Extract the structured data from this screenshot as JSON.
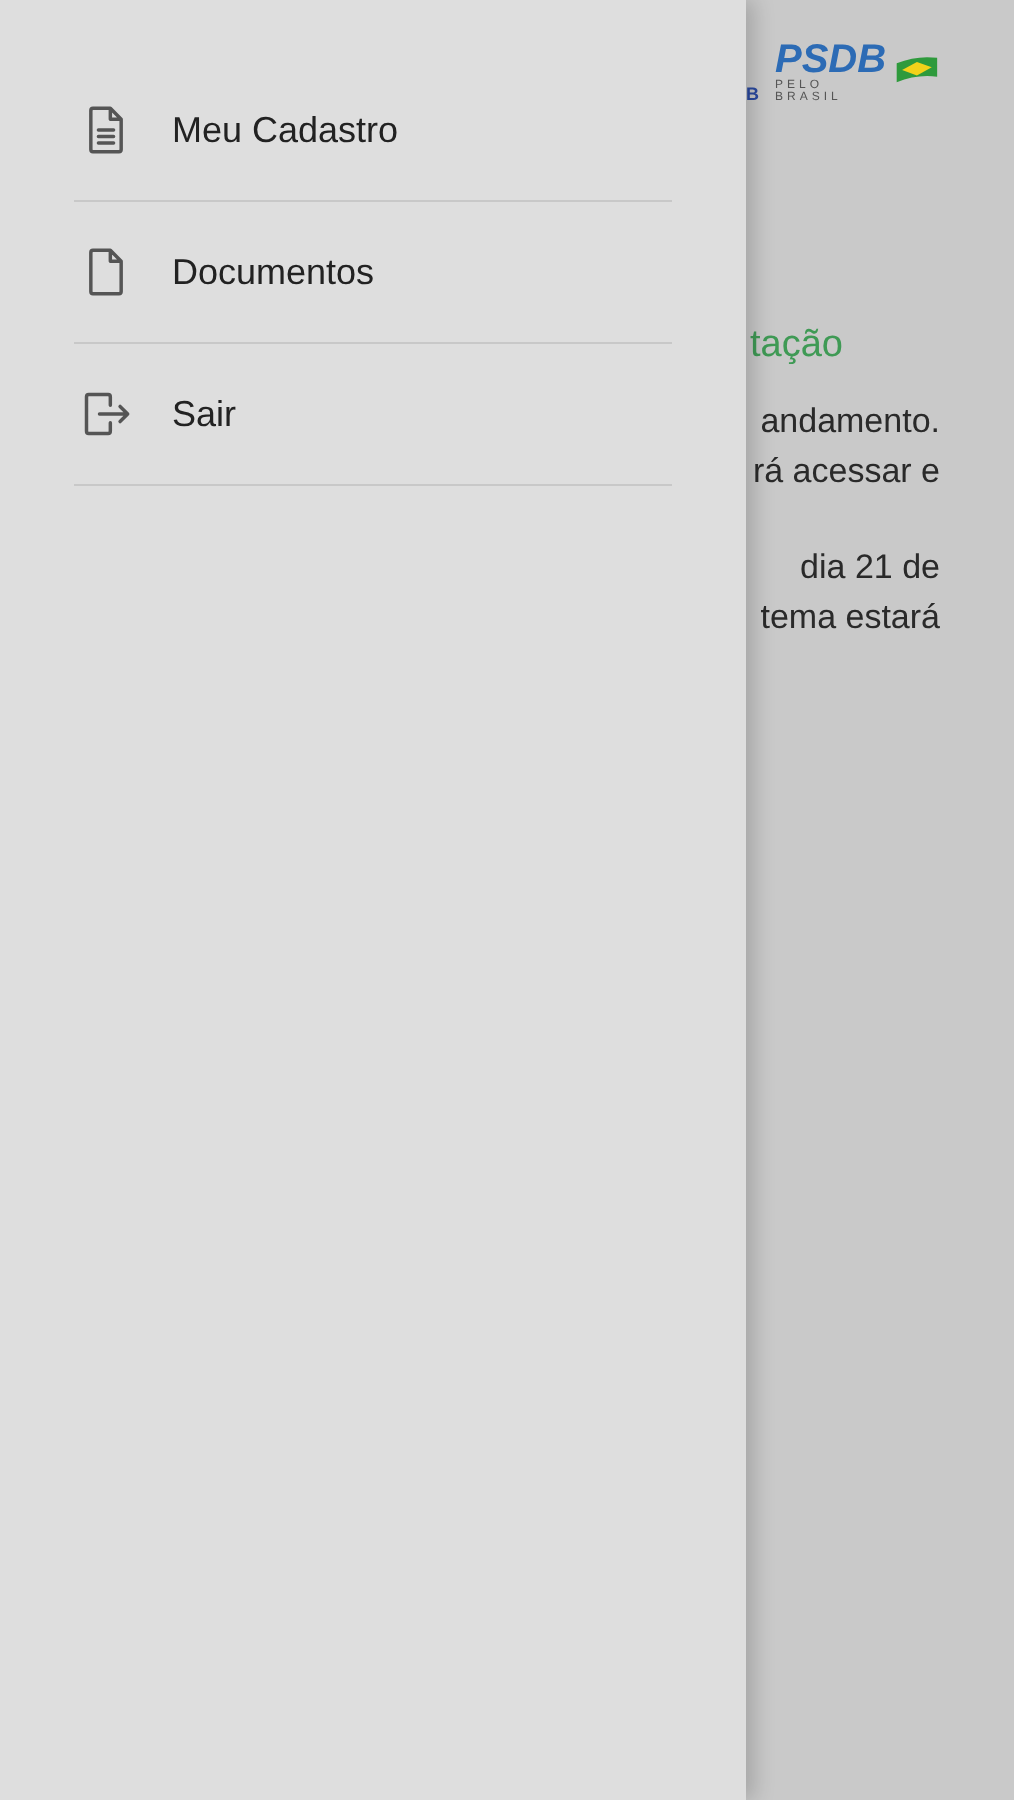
{
  "drawer": {
    "items": [
      {
        "kind": "file-lines",
        "label": "Meu Cadastro"
      },
      {
        "kind": "file",
        "label": "Documentos"
      },
      {
        "kind": "exit",
        "label": "Sair"
      }
    ]
  },
  "background": {
    "logo": {
      "partial": "B",
      "name": "PSDB",
      "tagline": "PELO BRASIL"
    },
    "heading": "tação",
    "paragraphs": [
      [
        "andamento.",
        "rá acessar e"
      ],
      [
        "dia 21 de",
        "tema estará"
      ]
    ]
  }
}
